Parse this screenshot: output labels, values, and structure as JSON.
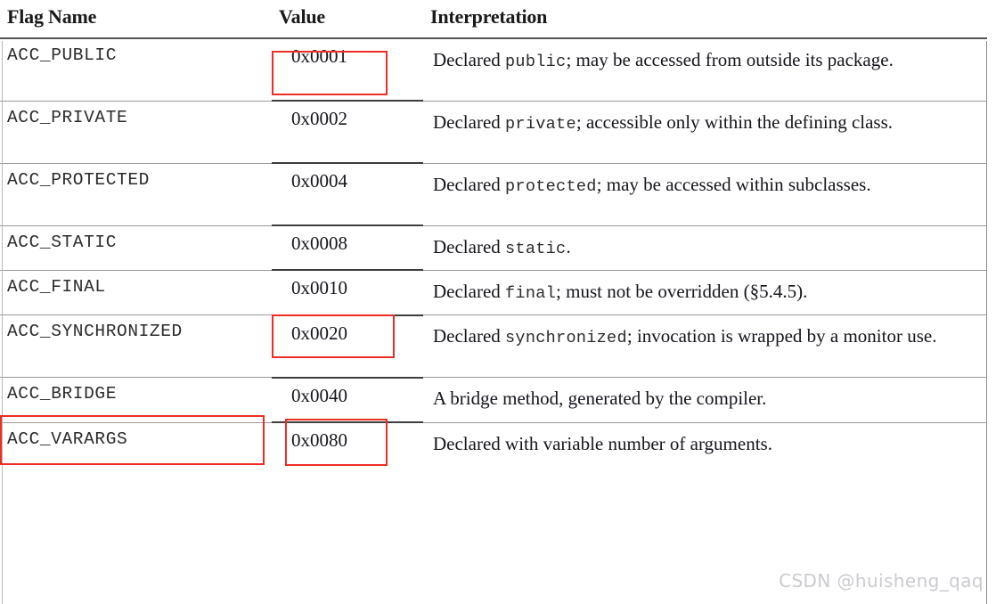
{
  "document": {
    "type": "table",
    "watermark": "CSDN @huisheng_qaq"
  },
  "table": {
    "headers": {
      "flag_name": "Flag Name",
      "value": "Value",
      "interpretation": "Interpretation"
    },
    "rows": [
      {
        "flag_name": "ACC_PUBLIC",
        "value": "0x0001",
        "interp_pre": "Declared ",
        "interp_code": "public",
        "interp_post": "; may be accessed from outside its package.",
        "justified": true
      },
      {
        "flag_name": "ACC_PRIVATE",
        "value": "0x0002",
        "interp_pre": "Declared ",
        "interp_code": "private",
        "interp_post": "; accessible only within the defining class.",
        "justified": true
      },
      {
        "flag_name": "ACC_PROTECTED",
        "value": "0x0004",
        "interp_pre": "Declared ",
        "interp_code": "protected",
        "interp_post": "; may be accessed within subclasses.",
        "justified": true
      },
      {
        "flag_name": "ACC_STATIC",
        "value": "0x0008",
        "interp_pre": "Declared ",
        "interp_code": "static",
        "interp_post": ".",
        "justified": false
      },
      {
        "flag_name": "ACC_FINAL",
        "value": "0x0010",
        "interp_pre": "Declared ",
        "interp_code": "final",
        "interp_post": "; must not be overridden (§5.4.5).",
        "justified": false
      },
      {
        "flag_name": "ACC_SYNCHRONIZED",
        "value": "0x0020",
        "interp_pre": "Declared ",
        "interp_code": "synchronized",
        "interp_post": "; invocation is wrapped by a monitor use.",
        "justified": true
      },
      {
        "flag_name": "ACC_BRIDGE",
        "value": "0x0040",
        "interp_pre": "",
        "interp_code": "",
        "interp_post": "A bridge method, generated by the compiler.",
        "justified": false
      },
      {
        "flag_name": "ACC_VARARGS",
        "value": "0x0080",
        "interp_pre": "",
        "interp_code": "",
        "interp_post": "Declared with variable number of arguments.",
        "justified": false
      }
    ]
  },
  "annotations": {
    "highlight_color": "#ee2d24",
    "boxes": [
      {
        "target": "value-0x0001"
      },
      {
        "target": "value-0x0008"
      },
      {
        "target": "flag-ACC_SYNCHRONIZED"
      },
      {
        "target": "value-0x0020"
      }
    ]
  }
}
